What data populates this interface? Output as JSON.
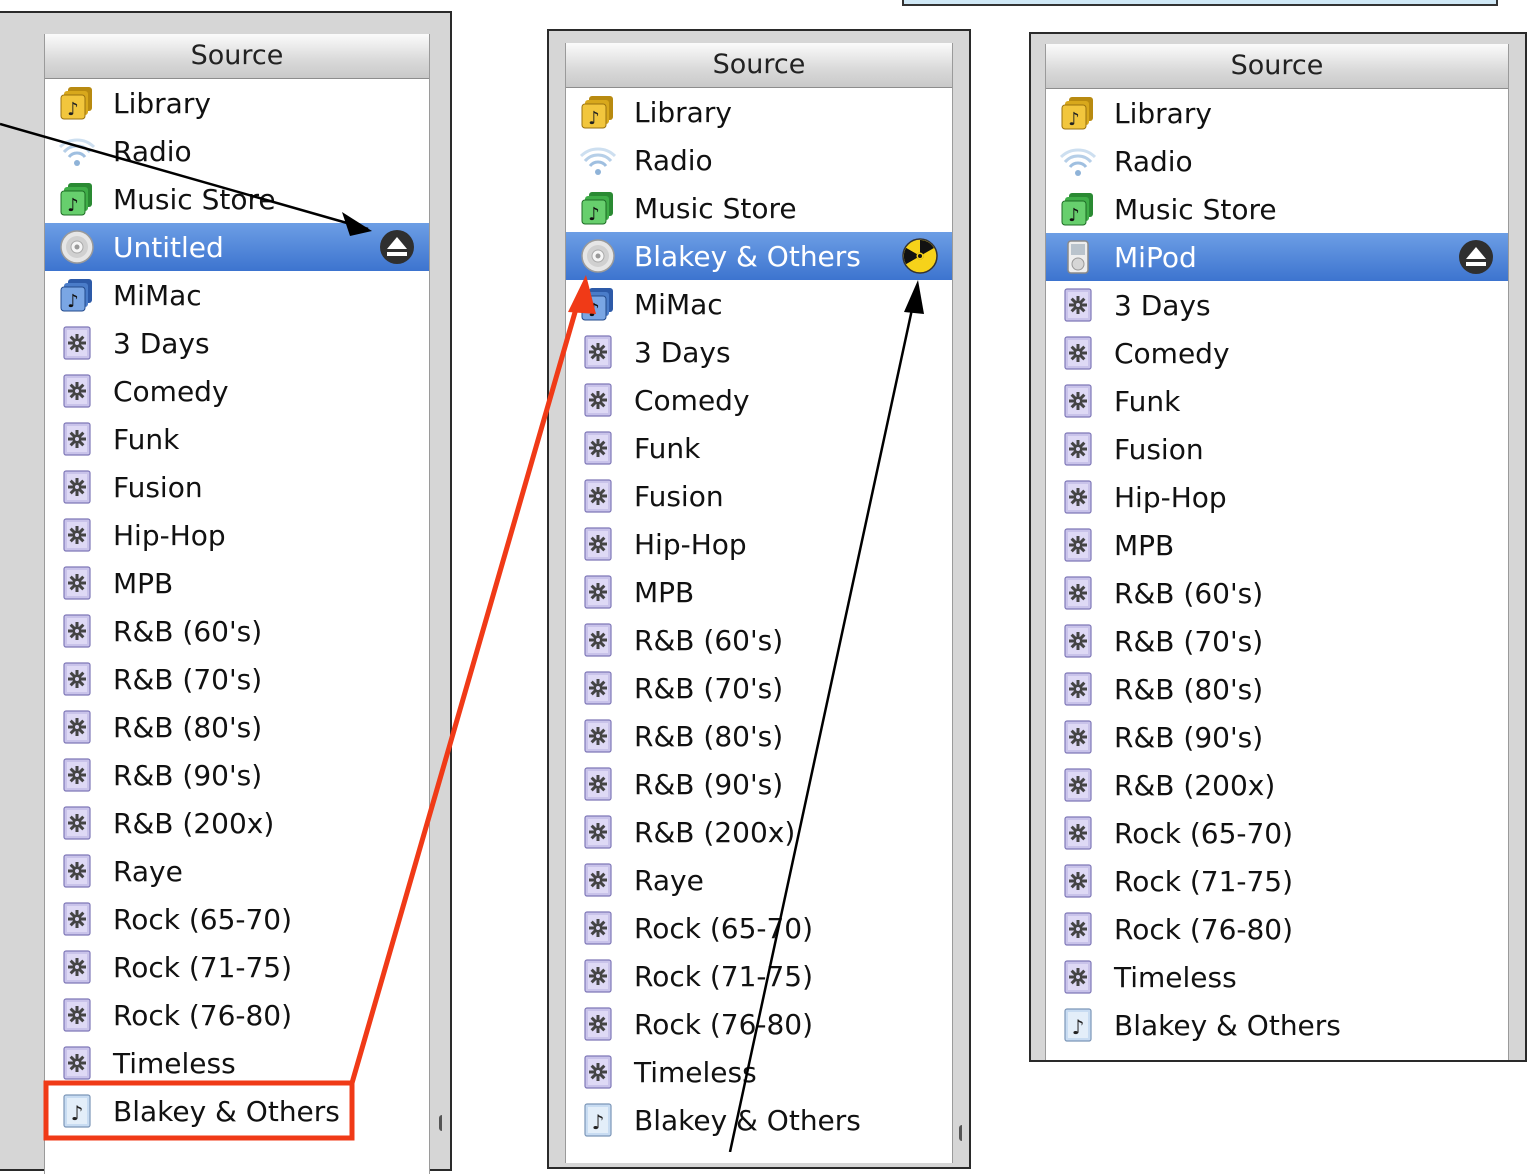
{
  "colors": {
    "selection": "#4f82d6",
    "annotation_red": "#f03a17",
    "annotation_black": "#000000",
    "banner": "#cfe8f6"
  },
  "panels": [
    {
      "header": "Source",
      "items": [
        {
          "label": "Library",
          "icon": "library-icon"
        },
        {
          "label": "Radio",
          "icon": "radio-icon"
        },
        {
          "label": "Music Store",
          "icon": "music-store-icon"
        },
        {
          "label": "Untitled",
          "icon": "cd-icon",
          "selected": true,
          "action_icon": "eject-icon"
        },
        {
          "label": "MiMac",
          "icon": "shared-library-icon"
        },
        {
          "label": "3 Days",
          "icon": "smart-playlist-icon"
        },
        {
          "label": "Comedy",
          "icon": "smart-playlist-icon"
        },
        {
          "label": "Funk",
          "icon": "smart-playlist-icon"
        },
        {
          "label": "Fusion",
          "icon": "smart-playlist-icon"
        },
        {
          "label": "Hip-Hop",
          "icon": "smart-playlist-icon"
        },
        {
          "label": "MPB",
          "icon": "smart-playlist-icon"
        },
        {
          "label": "R&B (60's)",
          "icon": "smart-playlist-icon"
        },
        {
          "label": "R&B (70's)",
          "icon": "smart-playlist-icon"
        },
        {
          "label": "R&B (80's)",
          "icon": "smart-playlist-icon"
        },
        {
          "label": "R&B (90's)",
          "icon": "smart-playlist-icon"
        },
        {
          "label": "R&B (200x)",
          "icon": "smart-playlist-icon"
        },
        {
          "label": "Raye",
          "icon": "smart-playlist-icon"
        },
        {
          "label": "Rock (65-70)",
          "icon": "smart-playlist-icon"
        },
        {
          "label": "Rock (71-75)",
          "icon": "smart-playlist-icon"
        },
        {
          "label": "Rock (76-80)",
          "icon": "smart-playlist-icon"
        },
        {
          "label": "Timeless",
          "icon": "smart-playlist-icon"
        },
        {
          "label": "Blakey & Others",
          "icon": "playlist-icon"
        }
      ]
    },
    {
      "header": "Source",
      "items": [
        {
          "label": "Library",
          "icon": "library-icon"
        },
        {
          "label": "Radio",
          "icon": "radio-icon"
        },
        {
          "label": "Music Store",
          "icon": "music-store-icon"
        },
        {
          "label": "Blakey & Others",
          "icon": "cd-icon",
          "selected": true,
          "action_icon": "burn-icon"
        },
        {
          "label": "MiMac",
          "icon": "shared-library-icon"
        },
        {
          "label": "3 Days",
          "icon": "smart-playlist-icon"
        },
        {
          "label": "Comedy",
          "icon": "smart-playlist-icon"
        },
        {
          "label": "Funk",
          "icon": "smart-playlist-icon"
        },
        {
          "label": "Fusion",
          "icon": "smart-playlist-icon"
        },
        {
          "label": "Hip-Hop",
          "icon": "smart-playlist-icon"
        },
        {
          "label": "MPB",
          "icon": "smart-playlist-icon"
        },
        {
          "label": "R&B (60's)",
          "icon": "smart-playlist-icon"
        },
        {
          "label": "R&B (70's)",
          "icon": "smart-playlist-icon"
        },
        {
          "label": "R&B (80's)",
          "icon": "smart-playlist-icon"
        },
        {
          "label": "R&B (90's)",
          "icon": "smart-playlist-icon"
        },
        {
          "label": "R&B (200x)",
          "icon": "smart-playlist-icon"
        },
        {
          "label": "Raye",
          "icon": "smart-playlist-icon"
        },
        {
          "label": "Rock (65-70)",
          "icon": "smart-playlist-icon"
        },
        {
          "label": "Rock (71-75)",
          "icon": "smart-playlist-icon"
        },
        {
          "label": "Rock (76-80)",
          "icon": "smart-playlist-icon"
        },
        {
          "label": "Timeless",
          "icon": "smart-playlist-icon"
        },
        {
          "label": "Blakey & Others",
          "icon": "playlist-icon"
        }
      ]
    },
    {
      "header": "Source",
      "items": [
        {
          "label": "Library",
          "icon": "library-icon"
        },
        {
          "label": "Radio",
          "icon": "radio-icon"
        },
        {
          "label": "Music Store",
          "icon": "music-store-icon"
        },
        {
          "label": "MiPod",
          "icon": "ipod-icon",
          "selected": true,
          "action_icon": "eject-icon"
        },
        {
          "label": "3 Days",
          "icon": "smart-playlist-icon"
        },
        {
          "label": "Comedy",
          "icon": "smart-playlist-icon"
        },
        {
          "label": "Funk",
          "icon": "smart-playlist-icon"
        },
        {
          "label": "Fusion",
          "icon": "smart-playlist-icon"
        },
        {
          "label": "Hip-Hop",
          "icon": "smart-playlist-icon"
        },
        {
          "label": "MPB",
          "icon": "smart-playlist-icon"
        },
        {
          "label": "R&B (60's)",
          "icon": "smart-playlist-icon"
        },
        {
          "label": "R&B (70's)",
          "icon": "smart-playlist-icon"
        },
        {
          "label": "R&B (80's)",
          "icon": "smart-playlist-icon"
        },
        {
          "label": "R&B (90's)",
          "icon": "smart-playlist-icon"
        },
        {
          "label": "R&B (200x)",
          "icon": "smart-playlist-icon"
        },
        {
          "label": "Rock (65-70)",
          "icon": "smart-playlist-icon"
        },
        {
          "label": "Rock (71-75)",
          "icon": "smart-playlist-icon"
        },
        {
          "label": "Rock (76-80)",
          "icon": "smart-playlist-icon"
        },
        {
          "label": "Timeless",
          "icon": "smart-playlist-icon"
        },
        {
          "label": "Blakey & Others",
          "icon": "playlist-icon"
        }
      ]
    }
  ]
}
